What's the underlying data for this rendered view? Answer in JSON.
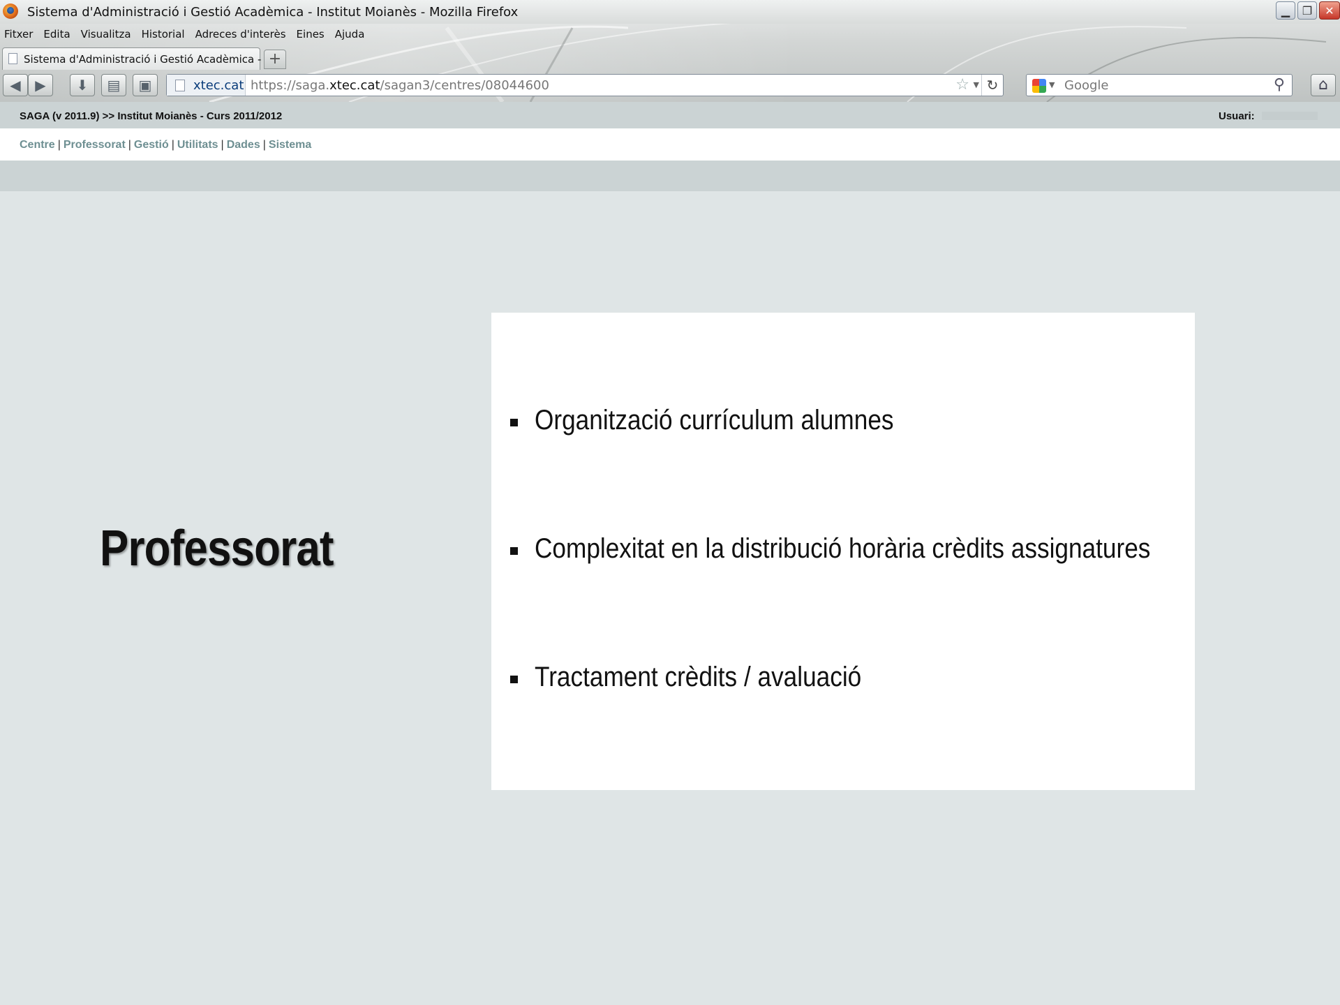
{
  "window": {
    "title": "Sistema d'Administració i Gestió Acadèmica - Institut Moianès - Mozilla Firefox",
    "buttons": {
      "minimize": "▁",
      "restore": "❐",
      "close": "✕"
    }
  },
  "menu": {
    "items": [
      "Fitxer",
      "Edita",
      "Visualitza",
      "Historial",
      "Adreces d'interès",
      "Eines",
      "Ajuda"
    ]
  },
  "tab": {
    "label": "Sistema d'Administració i Gestió Acadèmica - ...",
    "new_tab": "+"
  },
  "urlbar": {
    "site": "xtec.cat",
    "url_prefix": "https://saga.",
    "url_domain": "xtec.cat",
    "url_path": "/sagan3/centres/08044600"
  },
  "search": {
    "placeholder": "Google"
  },
  "saga": {
    "title": "SAGA (v 2011.9) >> Institut Moianès - Curs 2011/2012",
    "user_label": "Usuari:",
    "nav": [
      {
        "label": "Centre"
      },
      {
        "label": "Professorat"
      },
      {
        "label": "Gestió"
      },
      {
        "label": "Utilitats"
      },
      {
        "label": "Dades"
      },
      {
        "label": "Sistema"
      }
    ],
    "nav_separator": "|"
  },
  "slide": {
    "heading": "Professorat",
    "bullets": [
      "Organització currículum alumnes",
      "Complexitat en la distribució horària crèdits assignatures",
      "Tractament crèdits / avaluació"
    ]
  }
}
